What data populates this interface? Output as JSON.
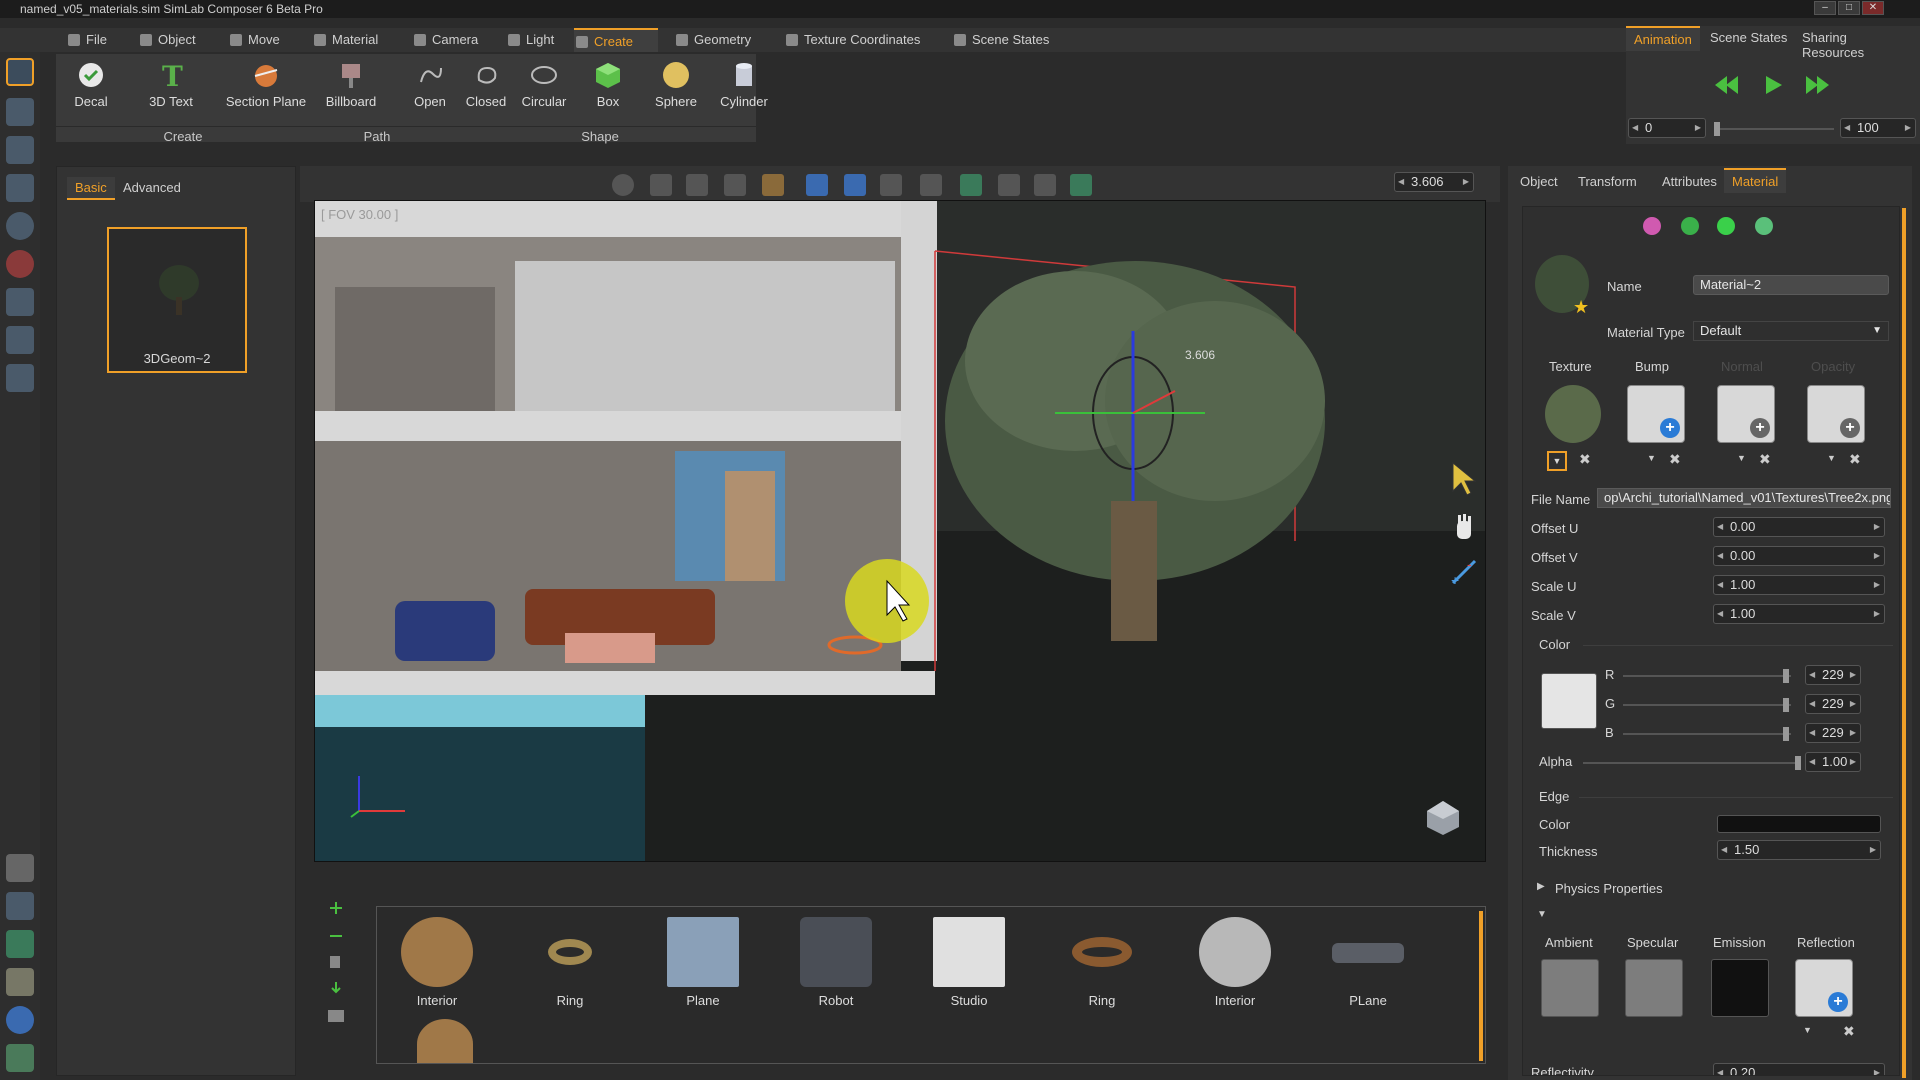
{
  "title": "named_v05_materials.sim SimLab Composer 6 Beta Pro",
  "menu": [
    "File",
    "Object",
    "Move",
    "Material",
    "Camera",
    "Light",
    "Create",
    "Geometry",
    "Texture Coordinates",
    "Scene States"
  ],
  "menu_active": "Create",
  "ribbon": {
    "buttons": [
      "Decal",
      "3D Text",
      "Section Plane",
      "Billboard",
      "Open",
      "Closed",
      "Circular",
      "Box",
      "Sphere",
      "Cylinder"
    ],
    "groups": [
      "Create",
      "Path",
      "Shape"
    ]
  },
  "left_panel": {
    "tabs": [
      "Basic",
      "Advanced"
    ],
    "thumb_label": "3DGeom~2"
  },
  "viewport": {
    "fov": "[ FOV 30.00 ]",
    "zoom_value": "3.606",
    "gizmo_label": "3.606"
  },
  "library": {
    "items": [
      "Interior",
      "Ring",
      "Plane",
      "Robot",
      "Studio",
      "Ring",
      "Interior",
      "PLane"
    ]
  },
  "right_top": {
    "tabs": [
      "Animation",
      "Scene States",
      "Sharing Resources"
    ],
    "start_frame": "0",
    "end_frame": "100"
  },
  "props": {
    "tabs": [
      "Object",
      "Transform",
      "Attributes",
      "Material"
    ],
    "name_label": "Name",
    "name_value": "Material~2",
    "type_label": "Material Type",
    "type_value": "Default",
    "slots": [
      "Texture",
      "Bump",
      "Normal",
      "Opacity"
    ],
    "file_label": "File Name",
    "file_value": "op\\Archi_tutorial\\Named_v01\\Textures\\Tree2x.png",
    "offset_u_label": "Offset U",
    "offset_u": "0.00",
    "offset_v_label": "Offset V",
    "offset_v": "0.00",
    "scale_u_label": "Scale U",
    "scale_u": "1.00",
    "scale_v_label": "Scale V",
    "scale_v": "1.00",
    "color_section": "Color",
    "r_label": "R",
    "r": "229",
    "g_label": "G",
    "g": "229",
    "b_label": "B",
    "b": "229",
    "alpha_label": "Alpha",
    "alpha": "1.00",
    "edge_section": "Edge",
    "edge_color_label": "Color",
    "thickness_label": "Thickness",
    "thickness": "1.50",
    "physics_label": "Physics Properties",
    "lighting": [
      "Ambient",
      "Specular",
      "Emission",
      "Reflection"
    ],
    "reflectivity_label": "Reflectivity",
    "reflectivity": "0.20"
  },
  "colors": {
    "accent": "#f0a028",
    "swatch_color": "#e5e5e5",
    "ambient": "#7d7d7d",
    "specular": "#7d7d7d",
    "emission": "#111111",
    "edge": "#111111"
  }
}
